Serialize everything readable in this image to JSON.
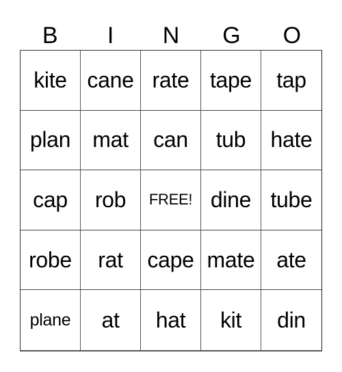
{
  "header": [
    "B",
    "I",
    "N",
    "G",
    "O"
  ],
  "cells": [
    [
      "kite",
      "cane",
      "rate",
      "tape",
      "tap"
    ],
    [
      "plan",
      "mat",
      "can",
      "tub",
      "hate"
    ],
    [
      "cap",
      "rob",
      "FREE!",
      "dine",
      "tube"
    ],
    [
      "robe",
      "rat",
      "cape",
      "mate",
      "ate"
    ],
    [
      "plane",
      "at",
      "hat",
      "kit",
      "din"
    ]
  ]
}
